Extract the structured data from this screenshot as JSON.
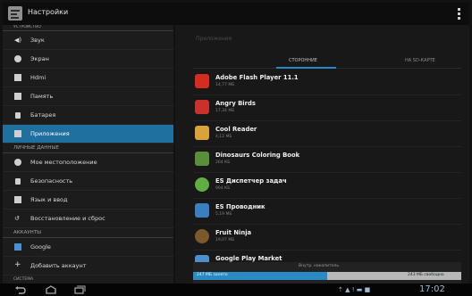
{
  "actionbar": {
    "title": "Настройки",
    "settings_icon": "settings-app-icon",
    "menu_icon": "overflow-menu-icon"
  },
  "left": {
    "section_device_partial": "УСТРОЙСТВО",
    "device_items": [
      {
        "label": "Звук",
        "icon": "speaker-icon"
      },
      {
        "label": "Экран",
        "icon": "brightness-icon"
      },
      {
        "label": "Hdmi",
        "icon": "hdmi-icon"
      },
      {
        "label": "Память",
        "icon": "storage-icon"
      },
      {
        "label": "Батарея",
        "icon": "battery-icon"
      },
      {
        "label": "Приложения",
        "icon": "apps-icon",
        "selected": true
      }
    ],
    "section_personal": "ЛИЧНЫЕ ДАННЫЕ",
    "personal_items": [
      {
        "label": "Мое местоположение",
        "icon": "location-icon"
      },
      {
        "label": "Безопасность",
        "icon": "lock-icon"
      },
      {
        "label": "Язык и ввод",
        "icon": "keyboard-icon"
      },
      {
        "label": "Восстановление и сброс",
        "icon": "restore-icon"
      }
    ],
    "section_accounts": "АККАУНТЫ",
    "account_items": [
      {
        "label": "Google",
        "icon": "google-icon"
      },
      {
        "label": "Добавить аккаунт",
        "icon": "plus-icon"
      }
    ],
    "section_system_partial": "СИСТЕМА"
  },
  "right": {
    "storage_title": "Приложения",
    "tabs": [
      "СТОРОННИЕ",
      "НА SD-КАРТЕ"
    ],
    "apps": [
      {
        "name": "Adobe Flash Player 11.1",
        "size": "14,77 МБ",
        "color": "#d62b1f"
      },
      {
        "name": "Angry Birds",
        "size": "17,34 МБ",
        "color": "#c8312d"
      },
      {
        "name": "Cool Reader",
        "size": "4,12 МБ",
        "color": "#d9a33a"
      },
      {
        "name": "Dinosaurs Coloring Book",
        "size": "264 КБ",
        "color": "#5a8f3a"
      },
      {
        "name": "ES Диспетчер задач",
        "size": "904 КБ",
        "color": "#5fae3f"
      },
      {
        "name": "ES Проводник",
        "size": "5,19 МБ",
        "color": "#3c7fc0"
      },
      {
        "name": "Fruit Ninja",
        "size": "19,07 МБ",
        "color": "#7a5a2a"
      },
      {
        "name": "Google Play Market",
        "size": "",
        "color": "#4c8ed0"
      }
    ],
    "storage": {
      "label": "Внутр. накопитель",
      "used": "247 МБ занято",
      "free": "243 МБ свободно",
      "used_fraction": 0.5
    }
  },
  "sysbar": {
    "time": "17:02",
    "status": "⇡ ▲ ! ▬ ■"
  },
  "colors": {
    "accent": "#2a8bc4",
    "selected_item": "#1f6f9f",
    "clock": "#9bbbd1"
  }
}
